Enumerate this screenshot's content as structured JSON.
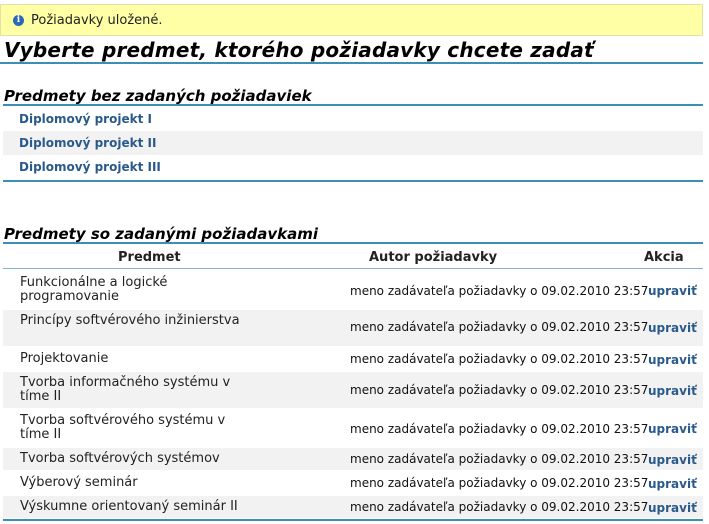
{
  "notice": {
    "icon": "info-icon",
    "text": "Požiadavky uložené."
  },
  "page_title": "Vyberte predmet, ktorého požiadavky chcete zadať",
  "section_without": {
    "title": "Predmety bez zadaných požiadaviek",
    "items": [
      "Diplomový projekt I",
      "Diplomový projekt II",
      "Diplomový projekt III"
    ]
  },
  "section_with": {
    "title": "Predmety so zadanými požiadavkami",
    "columns": {
      "subject": "Predmet",
      "author": "Autor požiadavky",
      "action": "Akcia"
    },
    "rows": [
      {
        "subject": "Funkcionálne a logické programovanie",
        "author": "meno zadávateľa požiadavky o 09.02.2010 23:57",
        "action": "upraviť"
      },
      {
        "subject": "Princípy softvérového inžinierstva",
        "author": "meno zadávateľa požiadavky o 09.02.2010 23:57",
        "action": "upraviť"
      },
      {
        "subject": "Projektovanie",
        "author": "meno zadávateľa požiadavky o 09.02.2010 23:57",
        "action": "upraviť"
      },
      {
        "subject": "Tvorba informačného systému v tíme II",
        "author": "meno zadávateľa požiadavky o 09.02.2010 23:57",
        "action": "upraviť"
      },
      {
        "subject": "Tvorba softvérového systému v tíme II",
        "author": "meno zadávateľa požiadavky o 09.02.2010 23:57",
        "action": "upraviť"
      },
      {
        "subject": "Tvorba softvérových systémov",
        "author": "meno zadávateľa požiadavky o 09.02.2010 23:57",
        "action": "upraviť"
      },
      {
        "subject": "Výberový seminár",
        "author": "meno zadávateľa požiadavky o 09.02.2010 23:57",
        "action": "upraviť"
      },
      {
        "subject": "Výskumne orientovaný seminár II",
        "author": "meno zadávateľa požiadavky o 09.02.2010 23:57",
        "action": "upraviť"
      }
    ]
  }
}
